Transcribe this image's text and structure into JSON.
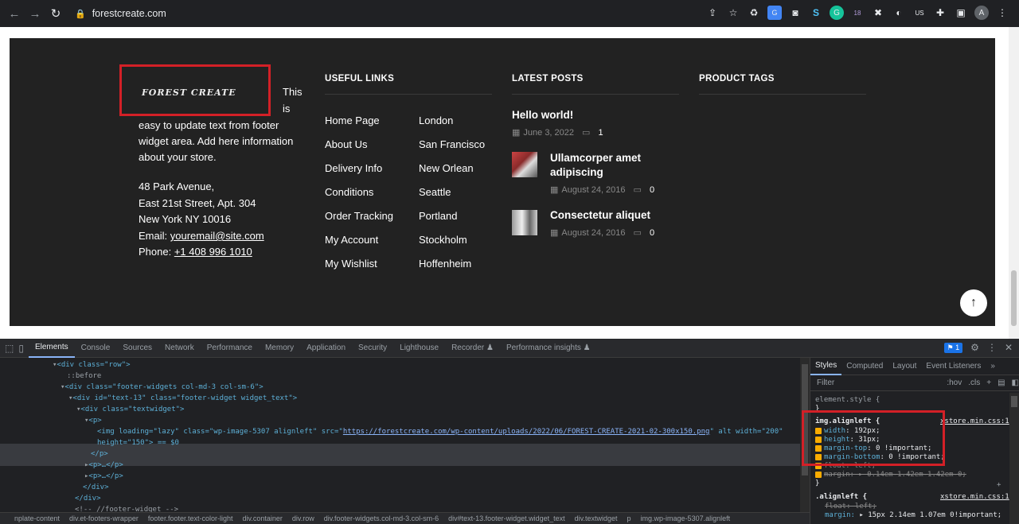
{
  "browser": {
    "url": "forestcreate.com",
    "extension_badges": [
      "18",
      "US"
    ]
  },
  "footer": {
    "logo_text": "FOREST CREATE",
    "about_inline_1": "This",
    "about_inline_2": "is",
    "about_lines": [
      "easy to update text from footer",
      "widget area. Add here information",
      "about your store."
    ],
    "address": [
      "48 Park Avenue,",
      "East 21st Street, Apt. 304",
      "New York NY 10016"
    ],
    "email_label": "Email: ",
    "email": "youremail@site.com",
    "phone_label": "Phone: ",
    "phone": "+1 408 996 1010",
    "useful_links_title": "USEFUL LINKS",
    "useful_links_left": [
      "Home Page",
      "About Us",
      "Delivery Info",
      "Conditions",
      "Order Tracking",
      "My Account",
      "My Wishlist"
    ],
    "useful_links_right": [
      "London",
      "San Francisco",
      "New Orlean",
      "Seattle",
      "Portland",
      "Stockholm",
      "Hoffenheim"
    ],
    "latest_posts_title": "LATEST POSTS",
    "posts": [
      {
        "title": "Hello world!",
        "date": "June 3, 2022",
        "comments": "1"
      },
      {
        "title_line1": "Ullamcorper amet",
        "title_line2": "adipiscing",
        "date": "August 24, 2016",
        "comments": "0"
      },
      {
        "title": "Consectetur aliquet",
        "date": "August 24, 2016",
        "comments": "0"
      }
    ],
    "product_tags_title": "PRODUCT TAGS",
    "to_top": "↑"
  },
  "devtools": {
    "tabs": [
      "Elements",
      "Console",
      "Sources",
      "Network",
      "Performance",
      "Memory",
      "Application",
      "Security",
      "Lighthouse",
      "Recorder ♟",
      "Performance insights ♟"
    ],
    "issues_count": "1",
    "dom": {
      "l1_tag": "<div class=\"row\">",
      "l2": "::before",
      "l3_tag": "<div class=\"footer-widgets col-md-3 col-sm-6\">",
      "l4_tag": "<div id=\"text-13\" class=\"footer-widget widget_text\">",
      "l5_tag": "<div class=\"textwidget\">",
      "l6_tag": "<p>",
      "l7_pre": "<img loading=\"lazy\" class=\"wp-image-5307 alignleft\" src=\"",
      "l7_src": "https://forestcreate.com/wp-content/uploads/2022/06/FOREST-CREATE-2021-02-300x150.png",
      "l7_post": "\" alt width=\"200\"",
      "l8": "height=\"150\"> == $0",
      "l9": "</p>",
      "l10": "<p>…</p>",
      "l11": "<p>…</p>",
      "l12": "</div>",
      "l13": "</div>",
      "l14": "<!-- //footer-widget -->"
    },
    "breadcrumbs": [
      "nplate-content",
      "div.et-footers-wrapper",
      "footer.footer.text-color-light",
      "div.container",
      "div.row",
      "div.footer-widgets.col-md-3.col-sm-6",
      "div#text-13.footer-widget.widget_text",
      "div.textwidget",
      "p",
      "img.wp-image-5307.alignleft"
    ],
    "styles_tabs": [
      "Styles",
      "Computed",
      "Layout",
      "Event Listeners"
    ],
    "filter_placeholder": "Filter",
    "hov": ":hov",
    "cls": ".cls",
    "element_style": "element.style {",
    "close_brace": "}",
    "rule1_selector": "img.alignleft {",
    "rule1_source": "xstore.min.css:1",
    "rule1_props": [
      {
        "name": "width",
        "value": "192px;"
      },
      {
        "name": "height",
        "value": "31px;"
      },
      {
        "name": "margin-top",
        "value": "0 !important;"
      },
      {
        "name": "margin-bottom",
        "value": "0 !important;"
      }
    ],
    "rule1_float": "float: left;",
    "rule1_margin": "margin: ▸ 0.14em-1.42em-1.42em-0;",
    "rule2_selector": ".alignleft {",
    "rule2_source": "xstore.min.css:1",
    "rule2_float": "float: left;",
    "rule2_margin_name": "margin:",
    "rule2_margin_value": "▸ 15px 2.14em 1.07em 0!important;"
  }
}
